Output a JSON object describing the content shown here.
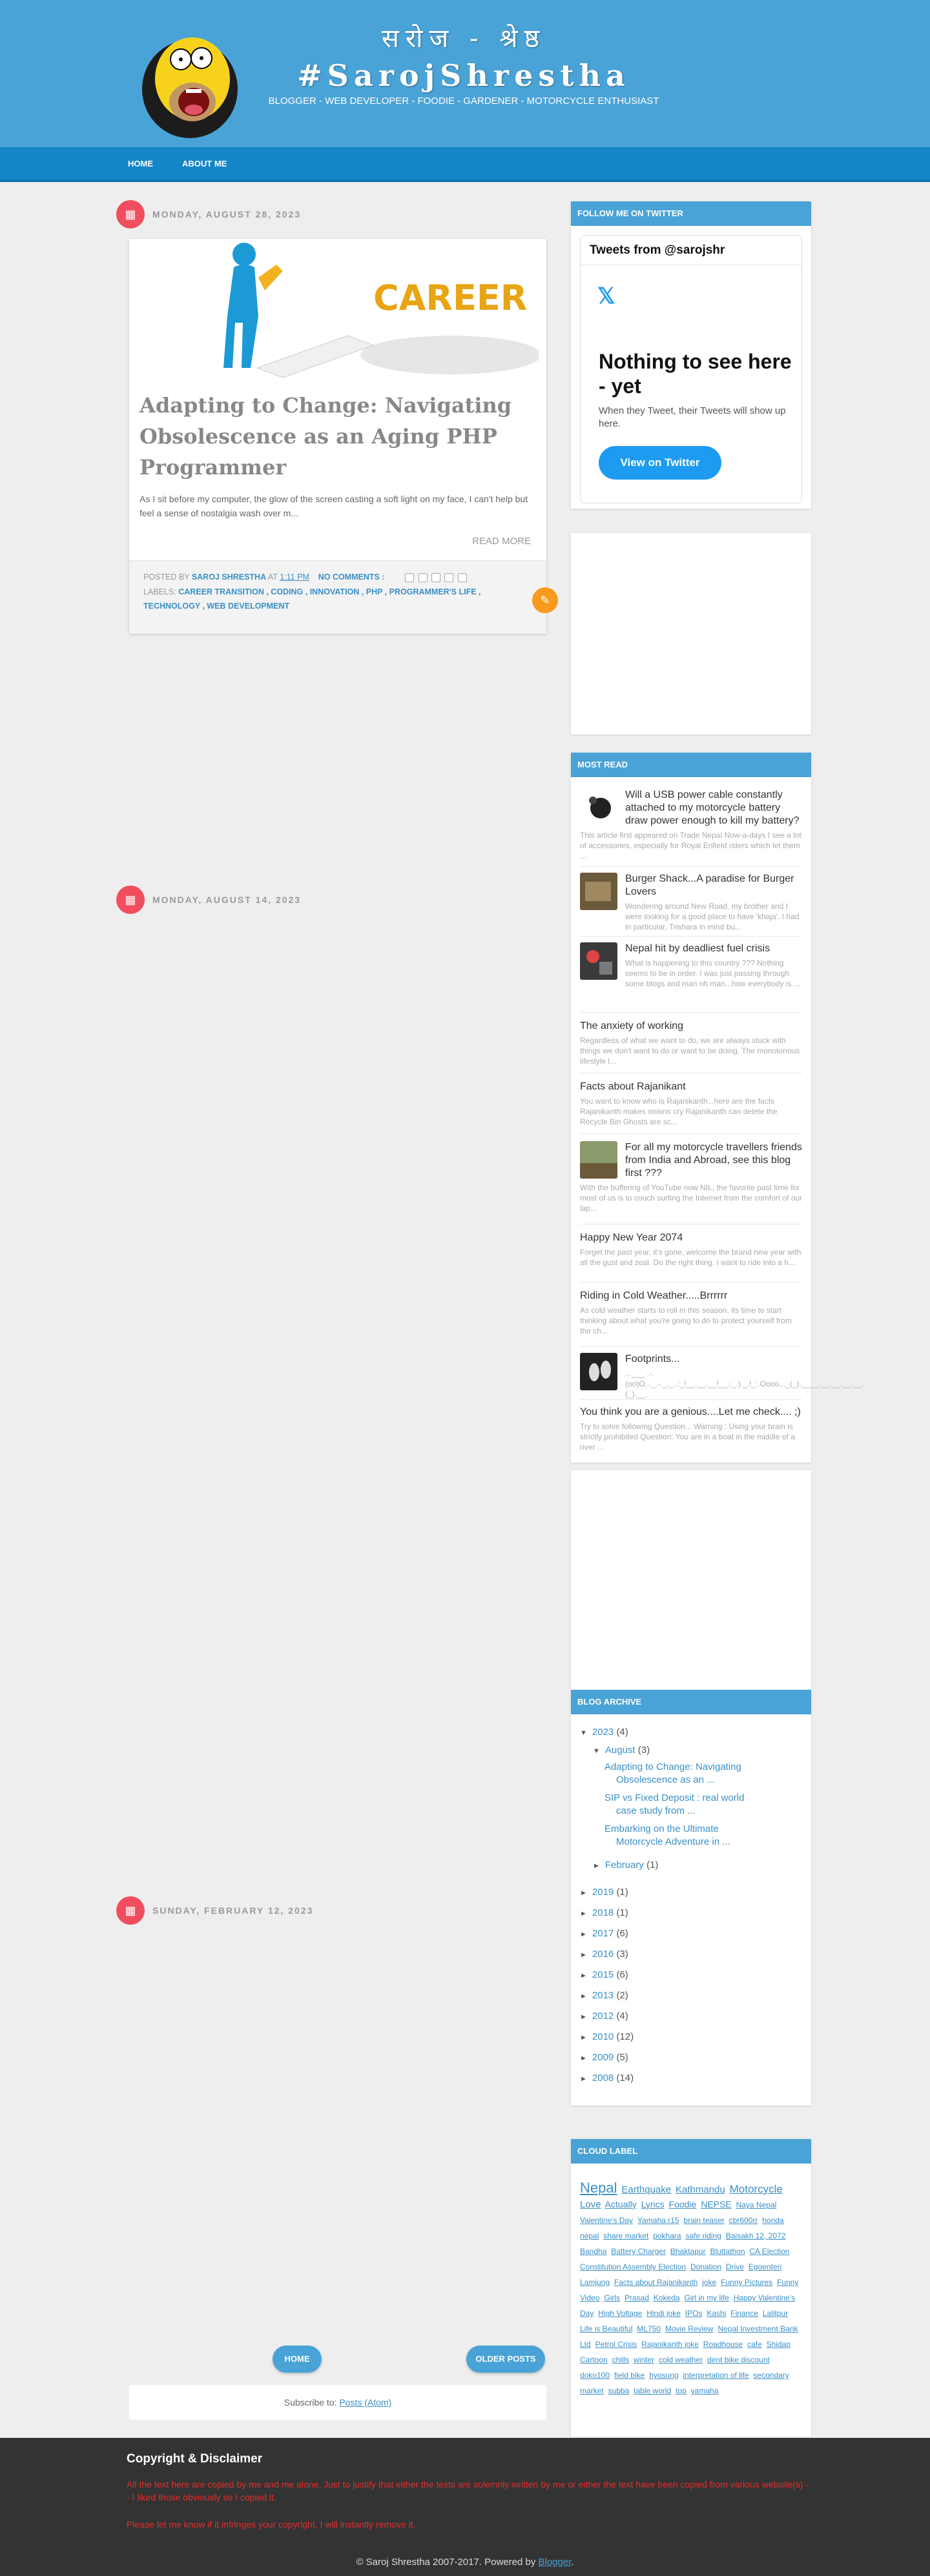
{
  "header": {
    "devanagari_title": "सरोज - श्रेष्ठ",
    "title": "#SarojShrestha",
    "tagline": "BLOGGER - WEB DEVELOPER - FOODIE - GARDENER - MOTORCYCLE ENTHUSIAST"
  },
  "nav": {
    "home": "HOME",
    "about": "ABOUT ME"
  },
  "posts": [
    {
      "date": "MONDAY, AUGUST 28, 2023",
      "image_caption": "CAREER",
      "title": "Adapting to Change: Navigating Obsolescence as an Aging PHP Programmer",
      "snippet": "As I sit before my computer, the glow of the screen casting a soft light on my face, I can't help but feel a sense of nostalgia wash over m...",
      "read_more": "READ MORE",
      "posted_by": "POSTED BY",
      "author": "SAROJ SHRESTHA",
      "at": "AT",
      "time": "1:11 PM",
      "comments": "NO COMMENTS :",
      "labels_prefix": "LABELS:",
      "labels": "CAREER TRANSITION , CODING , INNOVATION , PHP , PROGRAMMER'S LIFE , TECHNOLOGY , WEB DEVELOPMENT"
    },
    {
      "date": "MONDAY, AUGUST 14, 2023"
    },
    {
      "date": "SUNDAY, FEBRUARY 12, 2023"
    }
  ],
  "pagination": {
    "home": "HOME",
    "older": "OLDER POSTS"
  },
  "subscribe": {
    "text": "Subscribe to:",
    "link": "Posts (Atom)"
  },
  "sidebar": {
    "twitter": {
      "heading": "FOLLOW ME ON TWITTER",
      "tweets_from": "Tweets from @sarojshr",
      "logo": "𝕏",
      "nothing": "Nothing to see here - yet",
      "when": "When they Tweet, their Tweets will show up here.",
      "button": "View on Twitter"
    },
    "most_read": {
      "heading": "MOST READ",
      "items": [
        {
          "title": "Will a USB power cable constantly attached to my motorcycle battery draw power enough to kill my battery?",
          "snippet": "This article first appeared on Trade Nepal Now-a-days I see a lot of accessories, especially for Royal Enfield riders which let them ..."
        },
        {
          "title": "Burger Shack...A paradise for Burger Lovers",
          "snippet": "Wondering around New Road, my brother and I were looking for a good place to have 'khaja'. I had in particular, Trishara in mind bu..."
        },
        {
          "title": "Nepal hit by deadliest fuel crisis",
          "snippet": "What is happening to this country ??? Nothing seems to be in order. I was just passing through some blogs and man oh man...how everybody is ..."
        },
        {
          "title": "The anxiety of working",
          "snippet": "Regardless of what we want to do, we are always stuck with things we don't want to do or want to be doing. The monotonous lifestyle l..."
        },
        {
          "title": "Facts about Rajanikant",
          "snippet": "You want to know who is Rajanikanth...here are the facts Rajanikanth makes onions cry Rajanikanth can delete the Recycle Bin Ghosts are sc..."
        },
        {
          "title": "For all my motorcycle travellers friends from India and Abroad, see this blog first ???",
          "snippet": "With the buffering of YouTube now NIL, the favorite past time for most of us is to couch surfing the Internet from the comfort of our lap..."
        },
        {
          "title": "Happy New Year 2074",
          "snippet": "Forget the past year, it's gone, welcome the brand new year with all the gust and zeal. Do the right thing. I want to ride into a h..."
        },
        {
          "title": "Riding in Cold Weather.....Brrrrrr",
          "snippet": "As cold weather starts to roll in this season, its time to start thinking about what you're going to do to protect yourself from the ch..."
        },
        {
          "title": "Footprints...",
          "snippet": "...___ .-.(oo)O..._.-._._..:_!__.__.__!__.:_.)._.!_:.Oooo..._(_).____.__.__.__.__.(_).__."
        },
        {
          "title": "You think you are a genious....Let me check.... ;)",
          "snippet": "Try to solve following Question... Warning : Using your brain is strictly prohibited Question: You are in a boat in the middle of a river ..."
        }
      ]
    },
    "archive": {
      "heading": "BLOG ARCHIVE",
      "year_2023": "2023",
      "count_2023": "(4)",
      "month": "August",
      "month_count": "(3)",
      "posts": [
        "Adapting to Change: Navigating Obsolescence as an ...",
        "SIP vs Fixed Deposit : real world case study from ...",
        "Embarking on the Ultimate Motorcycle Adventure in ..."
      ],
      "feb": "February",
      "feb_count": "(1)",
      "years": [
        {
          "y": "2019",
          "c": "(1)"
        },
        {
          "y": "2018",
          "c": "(1)"
        },
        {
          "y": "2017",
          "c": "(6)"
        },
        {
          "y": "2016",
          "c": "(3)"
        },
        {
          "y": "2015",
          "c": "(6)"
        },
        {
          "y": "2013",
          "c": "(2)"
        },
        {
          "y": "2012",
          "c": "(4)"
        },
        {
          "y": "2010",
          "c": "(12)"
        },
        {
          "y": "2009",
          "c": "(5)"
        },
        {
          "y": "2008",
          "c": "(14)"
        }
      ]
    },
    "cloud": {
      "heading": "CLOUD LABEL",
      "labels": [
        "Nepal",
        "Earthquake",
        "Kathmandu",
        "Motorcycle",
        "Love",
        "Actually",
        "Lyrics",
        "Foodie",
        "NEPSE",
        "Naya Nepal",
        "Valentine's Day",
        "Yamaha r15",
        "brain teaser",
        "cbr600rr",
        "honda nepal",
        "share market",
        "pokhara",
        "safe riding",
        "Baisakh 12, 2072",
        "Bandha",
        "Battery Charger",
        "Bhaktapur",
        "Bluttathon",
        "CA Election",
        "Constitution Assembly Election",
        "Donation",
        "Drive",
        "Egoenteri",
        "Lamjung",
        "Facts about Rajanikanth",
        "joke",
        "Funny Pictures",
        "Funny Video",
        "Girls",
        "Prasad",
        "Kokeda",
        "Girl in my life",
        "Happy Valentine's Day",
        "High Voltage",
        "Hindi joke",
        "IPOs",
        "Kashi",
        "Finance",
        "Lalitpur",
        "Life is Beautiful",
        "ML750",
        "Movie Review",
        "Nepal Investment Bank Ltd",
        "Petrol Crisis",
        "Rajanikanth joke",
        "Roadhouse",
        "cafe",
        "Shidap",
        "Cartoon",
        "chills",
        "winter",
        "cold weather",
        "dent bike discount",
        "doko100",
        "field bike",
        "hyosung",
        "interpretation of life",
        "secondary market",
        "subba",
        "table world",
        "top",
        "yamaha"
      ]
    }
  },
  "footer": {
    "title": "Copyright & Disclaimer",
    "line1": "All the text here are copied by me and me alone. Just to justify that either the texts are solemnly written by me or either the text have been copied from various website(s) -- I liked those obviously so I copied it.",
    "line2": "Please let me know if it infringes your copyright, I will instantly remove it.",
    "copyright": "© Saroj Shrestha 2007-2017. Powered by",
    "powered": "Blogger",
    "dot": "."
  }
}
